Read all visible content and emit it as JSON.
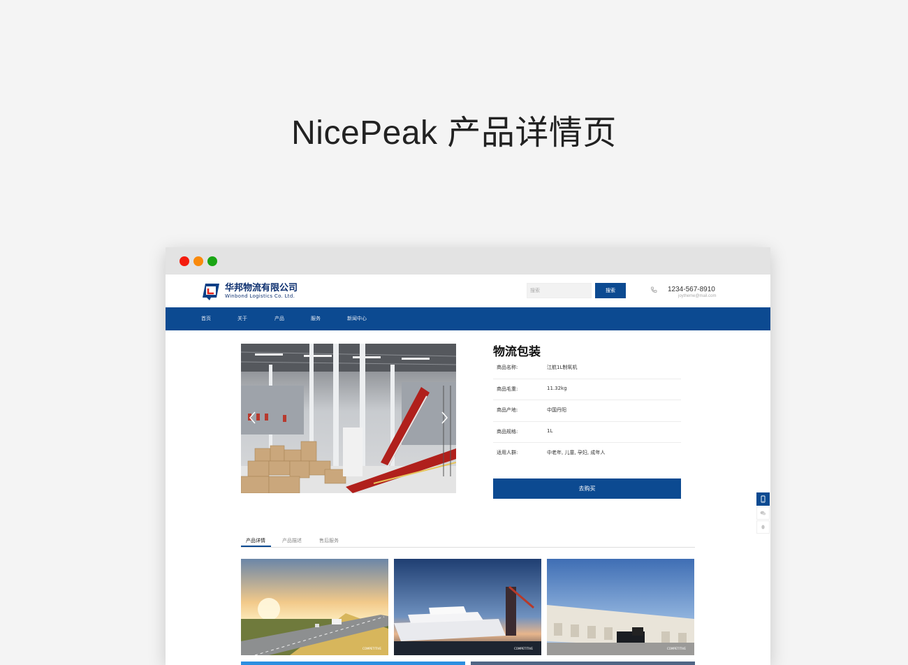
{
  "page": {
    "title": "NicePeak 产品详情页"
  },
  "site": {
    "logo": {
      "name_cn": "华邦物流有限公司",
      "name_en": "Winbond Logistics Co. Ltd."
    },
    "search": {
      "placeholder": "搜索",
      "button_label": "搜索"
    },
    "contact": {
      "phone": "1234-567-8910",
      "email": "joytheme@mail.com"
    }
  },
  "nav": {
    "items": [
      {
        "label": "首页"
      },
      {
        "label": "关于"
      },
      {
        "label": "产品"
      },
      {
        "label": "服务"
      },
      {
        "label": "新闻中心"
      }
    ]
  },
  "product": {
    "title": "物流包装",
    "specs": [
      {
        "label": "商品名称:",
        "value": "江航1L制氧机"
      },
      {
        "label": "商品毛重:",
        "value": "11.32kg"
      },
      {
        "label": "商品产地:",
        "value": "中国丹阳"
      },
      {
        "label": "商品规格:",
        "value": "1L"
      },
      {
        "label": "适用人群:",
        "value": "中老年, 儿童, 孕妇, 成年人"
      }
    ],
    "buy_label": "去购买"
  },
  "tabs": [
    {
      "label": "产品详情",
      "active": true
    },
    {
      "label": "产品描述",
      "active": false
    },
    {
      "label": "售后服务",
      "active": false
    }
  ],
  "thumbnails": [
    {
      "caption": "COMPETITIVE"
    },
    {
      "caption": "COMPETITIVE"
    },
    {
      "caption": "COMPETITIVE"
    }
  ],
  "colors": {
    "brand": "#0c4a91",
    "window_close": "#f41c0e",
    "window_min": "#f98a0c",
    "window_max": "#1aa514"
  },
  "icons": {
    "side_tools": [
      "mobile-icon",
      "wechat-icon",
      "qq-icon"
    ]
  }
}
